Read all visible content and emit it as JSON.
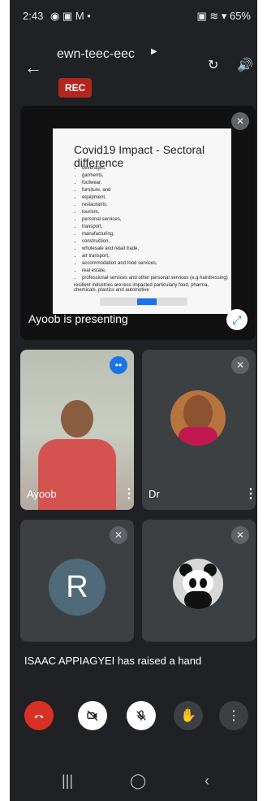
{
  "status_bar": {
    "time": "2:43",
    "icons": "◉ ▣ M •",
    "right": "▣ ≋ ▾ 65%"
  },
  "header": {
    "title": "ewn-teec-eec",
    "rec_label": "REC"
  },
  "presentation": {
    "slide_title": "Covid19 Impact - Sectoral difference",
    "bullets": [
      "beverages,",
      "garments,",
      "footwear,",
      "furniture, and",
      "equipment,",
      "restaurants,",
      "tourism,",
      "personal services,",
      "transport,",
      "manufacturing,",
      "construction,",
      "wholesale and retail trade,",
      "air transport,",
      "accommodation and food services,",
      "real estate,",
      "professional services and other personal services (e.g hairdressing)"
    ],
    "note": "resilient industries are less impacted particularly food, pharma, chemicals, plastics and automotive",
    "presenter_label": "Ayoob is presenting"
  },
  "participants": [
    {
      "name": "Ayoob"
    },
    {
      "name": "Dr"
    },
    {
      "initial": "R"
    },
    {
      "name": ""
    }
  ],
  "notifications": {
    "raised_hand": "ISAAC APPIAGYEI has raised a hand"
  },
  "colors": {
    "background": "#202124",
    "rec": "#b3261e",
    "accent": "#1a73e8",
    "end_call": "#d93025"
  },
  "icons": {
    "back": "back-arrow-icon",
    "more": "chevron-right-icon",
    "camera_switch": "camera-switch-icon",
    "speaker": "speaker-icon",
    "mute": "mic-off-icon",
    "fullscreen": "fullscreen-icon",
    "hang_up": "phone-hangup-icon",
    "video_off": "video-off-icon",
    "raise_hand": "hand-icon",
    "overflow": "more-vert-icon"
  }
}
